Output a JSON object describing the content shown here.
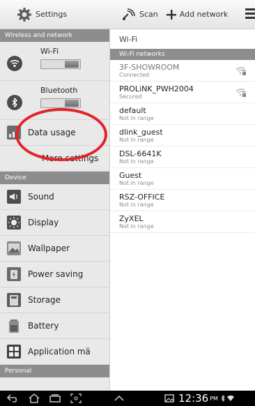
{
  "action_bar": {
    "app_title": "Settings",
    "scan_label": "Scan",
    "add_network_label": "Add network"
  },
  "left_pane": {
    "section_wireless": "Wireless and network",
    "wifi_label": "Wi-Fi",
    "bluetooth_label": "Bluetooth",
    "data_usage_label": "Data usage",
    "more_settings_label": "More settings",
    "section_device": "Device",
    "device_items": [
      {
        "label": "Sound",
        "icon": "sound-icon"
      },
      {
        "label": "Display",
        "icon": "display-icon"
      },
      {
        "label": "Wallpaper",
        "icon": "wallpaper-icon"
      },
      {
        "label": "Power saving",
        "icon": "power-saving-icon"
      },
      {
        "label": "Storage",
        "icon": "storage-icon"
      },
      {
        "label": "Battery",
        "icon": "battery-icon"
      },
      {
        "label": "Application mä",
        "icon": "application-manager-icon"
      }
    ],
    "section_personal": "Personal"
  },
  "right_pane": {
    "title": "Wi-Fi",
    "networks_header": "Wi-Fi networks",
    "networks": [
      {
        "ssid": "3F-SHOWROOM",
        "status": "Connected",
        "signal": true,
        "dim": true
      },
      {
        "ssid": "PROLiNK_PWH2004",
        "status": "Secured",
        "signal": true,
        "dim": false
      },
      {
        "ssid": "default",
        "status": "Not in range",
        "signal": false,
        "dim": false
      },
      {
        "ssid": "dlink_guest",
        "status": "Not in range",
        "signal": false,
        "dim": false
      },
      {
        "ssid": "DSL-6641K",
        "status": "Not in range",
        "signal": false,
        "dim": false
      },
      {
        "ssid": "Guest",
        "status": "Not in range",
        "signal": false,
        "dim": false
      },
      {
        "ssid": "RSZ-OFFICE",
        "status": "Not in range",
        "signal": false,
        "dim": false
      },
      {
        "ssid": "ZyXEL",
        "status": "Not in range",
        "signal": false,
        "dim": false
      }
    ]
  },
  "system_bar": {
    "time": "12:36",
    "ampm": "PM"
  },
  "colors": {
    "section_header": "#8d8d8d",
    "highlight_circle": "#e2232a"
  }
}
